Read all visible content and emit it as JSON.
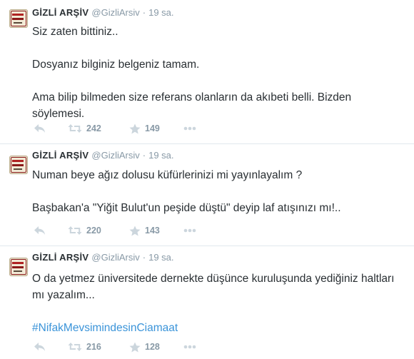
{
  "tweets": [
    {
      "author_name": "GİZLİ ARŞİV",
      "handle": "@GizliArsiv",
      "separator": "·",
      "time": "19 sa.",
      "paragraphs": [
        "Siz zaten bittiniz..",
        "Dosyanız bilginiz belgeniz tamam.",
        "Ama bilip bilmeden size referans olanların da akıbeti belli. Bizden söylemesi."
      ],
      "retweets": "242",
      "favorites": "149"
    },
    {
      "author_name": "GİZLİ ARŞİV",
      "handle": "@GizliArsiv",
      "separator": "·",
      "time": "19 sa.",
      "paragraphs": [
        "Numan beye ağız dolusu küfürlerinizi mi yayınlayalım ?",
        "Başbakan'a \"Yiğit Bulut'un peşide düştü\" deyip laf atışınızı mı!.."
      ],
      "retweets": "220",
      "favorites": "143"
    },
    {
      "author_name": "GİZLİ ARŞİV",
      "handle": "@GizliArsiv",
      "separator": "·",
      "time": "19 sa.",
      "paragraphs": [
        "O da yetmez üniversitede dernekte düşünce kuruluşunda yediğiniz haltları mı yazalım..."
      ],
      "hashtag": "#NifakMevsimindesinCiamaat",
      "retweets": "216",
      "favorites": "128"
    }
  ],
  "icons": {
    "reply": "reply-icon",
    "retweet": "retweet-icon",
    "favorite": "star-icon",
    "more": "more-icon"
  },
  "colors": {
    "text": "#292f33",
    "muted": "#8899a6",
    "icon": "#ccd6dd",
    "link": "#3b94d9",
    "divider": "#e1e8ed"
  }
}
